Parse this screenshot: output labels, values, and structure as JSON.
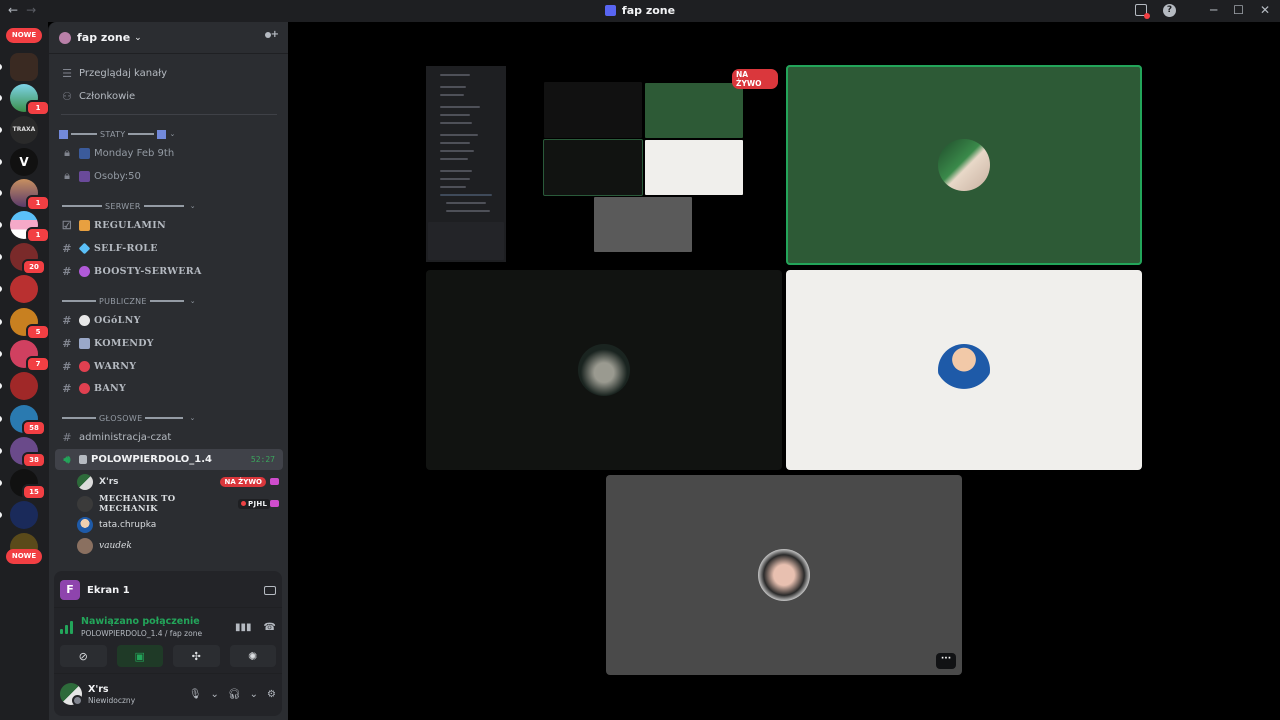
{
  "titlebar": {
    "back": "←",
    "forward": "→",
    "title": "fap zone"
  },
  "rail": {
    "new_top": "NOWE",
    "new_bottom": "NOWE",
    "server_v": "V",
    "server_traxa": "TRAXA",
    "badges": [
      "1",
      "1",
      "1",
      "20",
      "5",
      "7",
      "58",
      "38",
      "15"
    ]
  },
  "server": {
    "name": "fap zone"
  },
  "top_items": {
    "browse": "Przeglądaj kanały",
    "members": "Członkowie"
  },
  "categories": {
    "staty": "STATY",
    "serwer": "SERWER",
    "publiczne": "PUBLICZNE",
    "glosowe": "GŁOSOWE"
  },
  "channels": {
    "date": "Monday Feb 9th",
    "osoby": "Osoby:50",
    "regulamin": "REGULAMIN",
    "self_role": "SELF-ROLE",
    "boosty": "BOOSTY-SERWERA",
    "ogolny": "OGóLNY",
    "komendy": "KOMENDY",
    "warny": "WARNY",
    "bany": "BANY",
    "admin_czat": "administracja-czat",
    "voice": "POLOWPIERDOLO_1.4",
    "voice_timer": "52:27"
  },
  "voice_users": {
    "u1": "X'rs",
    "u1_live": "NA ŻYWO",
    "u2": "MECHANIK TO MECHANIK",
    "u2_tag": "PJHL",
    "u3": "tata.chrupka",
    "u4": "vaudek"
  },
  "panel": {
    "screen_label": "Ekran 1",
    "screen_initial": "F",
    "status": "Nawiązano połączenie",
    "where": "POLOWPIERDOLO_1.4 / fap zone",
    "user_name": "X'rs",
    "user_status": "Niewidoczny"
  },
  "stage": {
    "live": "NA ŻYWO",
    "more": "···"
  },
  "colors": {
    "live": "#da373c",
    "connected": "#23a55a",
    "speaking_bg": "#2d5a36",
    "light_tile": "#f0efec",
    "dark_tile": "#111311",
    "gray_tile": "#4a4a4a"
  }
}
